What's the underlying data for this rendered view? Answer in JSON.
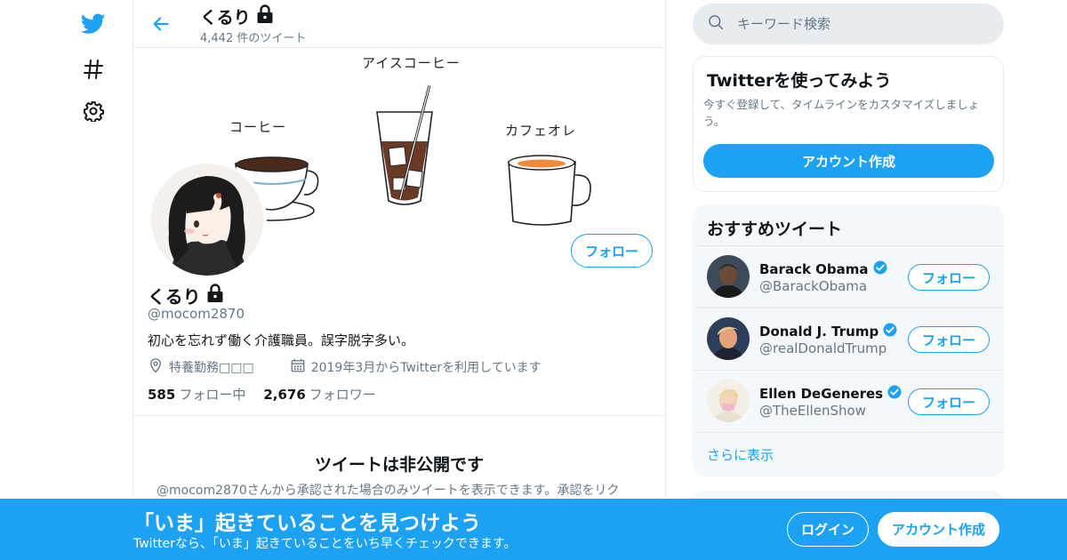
{
  "colors": {
    "accent": "#1da1f2",
    "text_secondary": "#657786",
    "border": "#e6ecf0"
  },
  "nav": {
    "icons": [
      "twitter-bird-icon",
      "hashtag-icon",
      "gear-icon"
    ]
  },
  "header": {
    "name": "くるり",
    "tweet_count": "4,442 件のツイート"
  },
  "banner": {
    "labels": {
      "coffee": "コーヒー",
      "iced_coffee": "アイスコーヒー",
      "cafe_au_lait": "カフェオレ"
    }
  },
  "profile": {
    "follow_label": "フォロー",
    "name": "くるり",
    "handle": "@mocom2870",
    "bio": "初心を忘れず働く介護職員。誤字脱字多い。",
    "location": "特養勤務□□□",
    "joined": "2019年3月からTwitterを利用しています",
    "following_count": "585",
    "following_label": "フォロー中",
    "followers_count": "2,676",
    "followers_label": "フォロワー"
  },
  "private": {
    "title": "ツイートは非公開です",
    "description": "@mocom2870さんから承認された場合のみツイートを表示できます。承認をリク"
  },
  "search": {
    "placeholder": "キーワード検索"
  },
  "signup_card": {
    "title": "Twitterを使ってみよう",
    "description": "今すぐ登録して、タイムラインをカスタマイズしましょう。",
    "button": "アカウント作成"
  },
  "suggestions": {
    "title": "おすすめツイート",
    "items": [
      {
        "name": "Barack Obama",
        "handle": "@BarackObama",
        "follow": "フォロー"
      },
      {
        "name": "Donald J. Trump",
        "handle": "@realDonaldTrump",
        "follow": "フォロー"
      },
      {
        "name": "Ellen DeGeneres",
        "handle": "@TheEllenShow",
        "follow": "フォロー"
      }
    ],
    "show_more": "さらに表示"
  },
  "bottom_bar": {
    "title": "「いま」起きていることを見つけよう",
    "subtitle": "Twitterなら、「いま」起きていることをいち早くチェックできます。",
    "login": "ログイン",
    "signup": "アカウント作成"
  }
}
